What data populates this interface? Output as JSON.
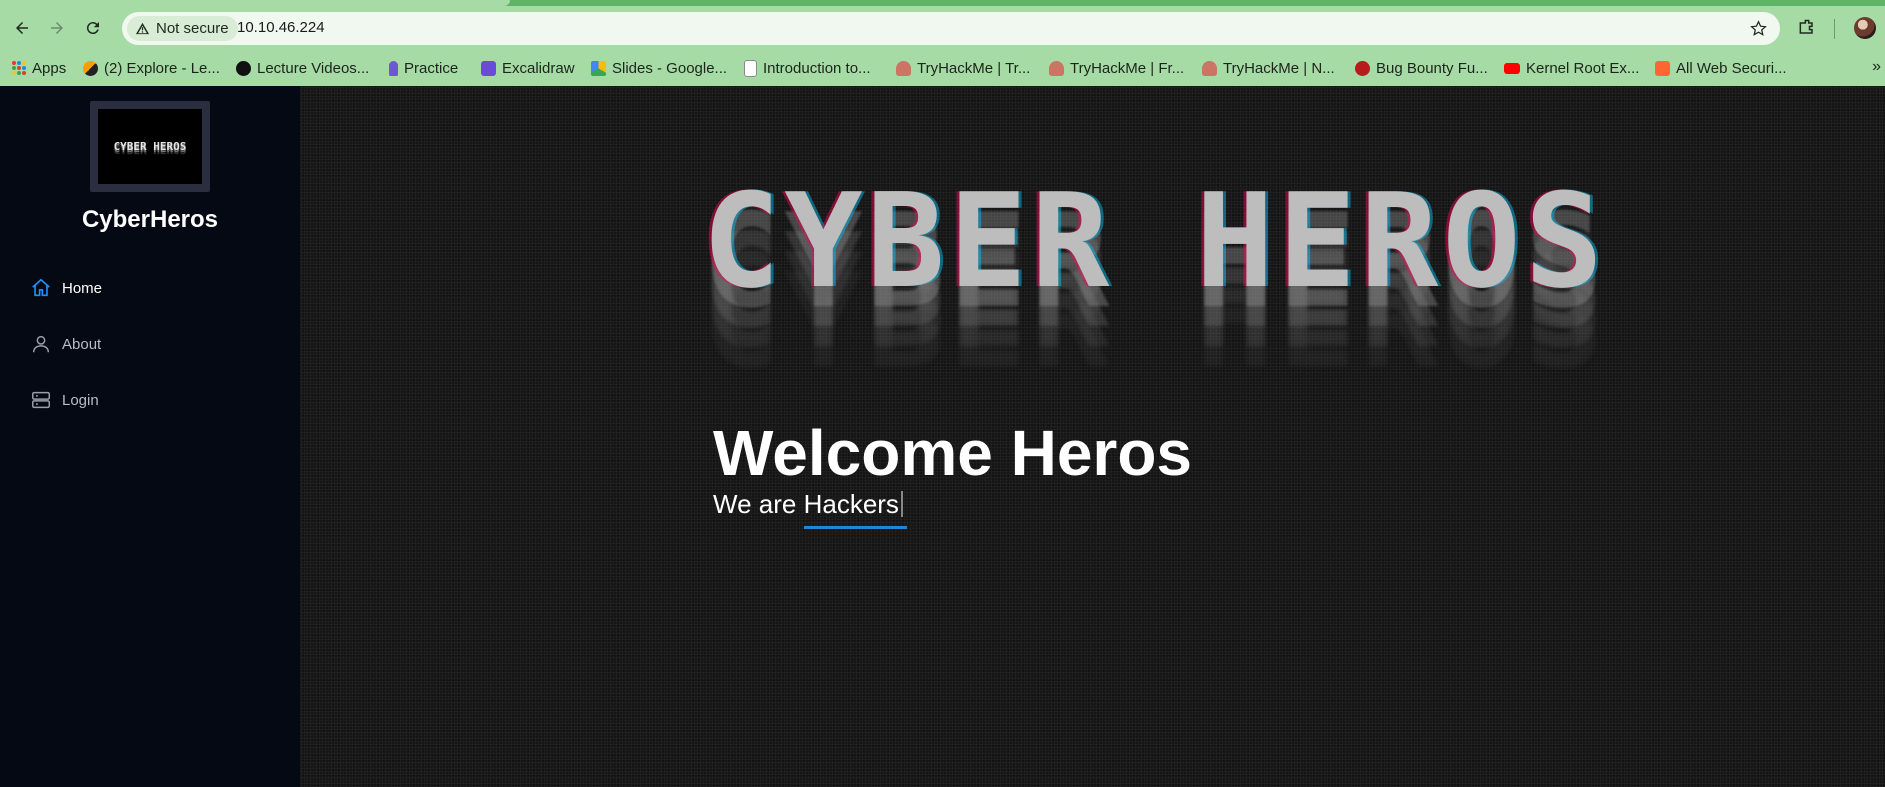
{
  "browser": {
    "security_label": "Not secure",
    "url": "10.10.46.224",
    "bookmarks": [
      {
        "label": "Apps",
        "icon": "apps-grid-icon"
      },
      {
        "label": "(2) Explore - Le...",
        "icon": "leetcode-icon"
      },
      {
        "label": "Lecture Videos...",
        "icon": "lecture-icon"
      },
      {
        "label": "Practice",
        "icon": "practice-icon"
      },
      {
        "label": "Excalidraw",
        "icon": "excalidraw-icon"
      },
      {
        "label": "Slides - Google...",
        "icon": "google-drive-icon"
      },
      {
        "label": "Introduction to...",
        "icon": "doc-icon"
      },
      {
        "label": "TryHackMe | Tr...",
        "icon": "tryhackme-icon"
      },
      {
        "label": "TryHackMe | Fr...",
        "icon": "tryhackme-icon"
      },
      {
        "label": "TryHackMe | N...",
        "icon": "tryhackme-icon"
      },
      {
        "label": "Bug Bounty Fu...",
        "icon": "bug-bounty-icon"
      },
      {
        "label": "Kernel Root Ex...",
        "icon": "youtube-icon"
      },
      {
        "label": "All Web Securi...",
        "icon": "portswigger-icon"
      }
    ],
    "more_label": "»"
  },
  "sidebar": {
    "logo_text": "CYBER HEROS",
    "site_title": "CyberHeros",
    "nav": [
      {
        "label": "Home",
        "icon": "home-icon",
        "active": true
      },
      {
        "label": "About",
        "icon": "user-icon",
        "active": false
      },
      {
        "label": "Login",
        "icon": "server-icon",
        "active": false
      }
    ]
  },
  "main": {
    "banner_text": "CYBER HEROS",
    "heading": "Welcome Heros",
    "tagline_prefix": "We are",
    "tagline_typed": "Hackers"
  },
  "colors": {
    "chrome": "#a7dba6",
    "sidebar": "#050914",
    "accent": "#1c86d8"
  }
}
